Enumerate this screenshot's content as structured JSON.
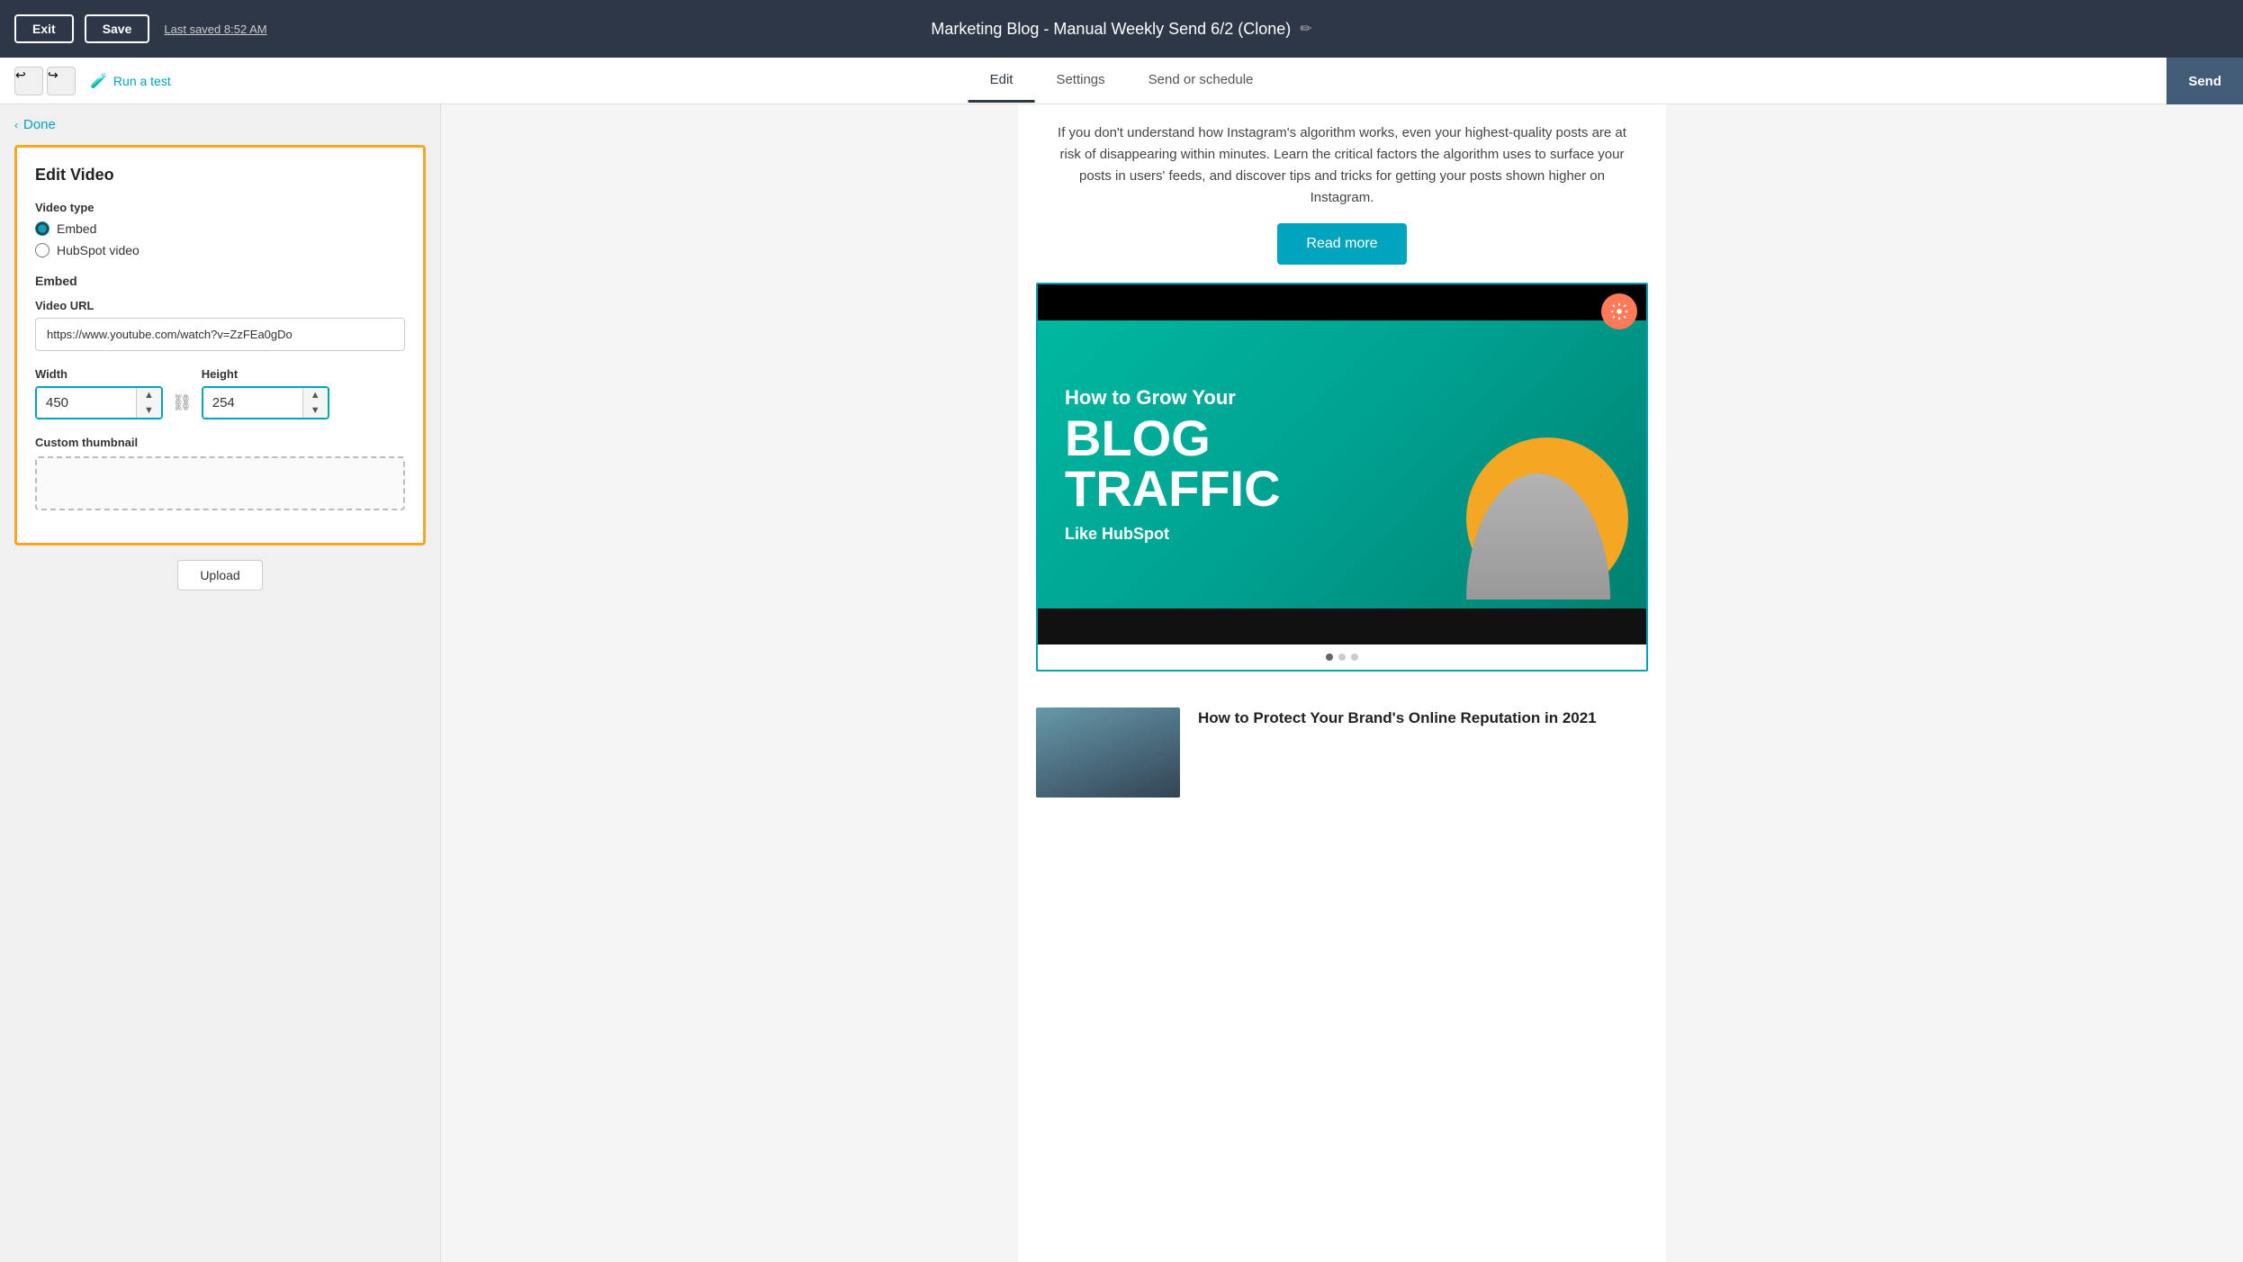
{
  "topbar": {
    "exit_label": "Exit",
    "save_label": "Save",
    "last_saved": "Last saved 8:52 AM",
    "title": "Marketing Blog - Manual Weekly Send 6/2 (Clone)",
    "edit_icon": "✏"
  },
  "navbar": {
    "run_test_label": "Run a test",
    "tabs": [
      {
        "id": "edit",
        "label": "Edit",
        "active": true
      },
      {
        "id": "settings",
        "label": "Settings",
        "active": false
      },
      {
        "id": "send_schedule",
        "label": "Send or schedule",
        "active": false
      }
    ],
    "send_label": "Send"
  },
  "left_panel": {
    "done_label": "Done",
    "edit_video_title": "Edit Video",
    "video_type_label": "Video type",
    "radio_embed_label": "Embed",
    "radio_hubspot_label": "HubSpot video",
    "embed_section_label": "Embed",
    "video_url_label": "Video URL",
    "video_url_value": "https://www.youtube.com/watch?v=ZzFEa0gDo",
    "width_label": "Width",
    "width_value": "450",
    "height_label": "Height",
    "height_value": "254",
    "custom_thumbnail_label": "Custom thumbnail",
    "upload_label": "Upload"
  },
  "email_preview": {
    "article_text": "If you don't understand how Instagram's algorithm works, even your highest-quality posts are at risk of disappearing within minutes. Learn the critical factors the algorithm uses to surface your posts in users' feeds, and discover tips and tricks for getting your posts shown higher on Instagram.",
    "read_more_label": "Read more",
    "video_how_to": "How to Grow Your",
    "video_blog": "BLOG",
    "video_traffic": "TRAFFIC",
    "video_like": "Like HubSpot",
    "bottom_article_title": "How to Protect Your Brand's Online Reputation in 2021"
  },
  "colors": {
    "orange_border": "#f5a623",
    "teal": "#00a4bd",
    "topbar_bg": "#2d3748"
  }
}
